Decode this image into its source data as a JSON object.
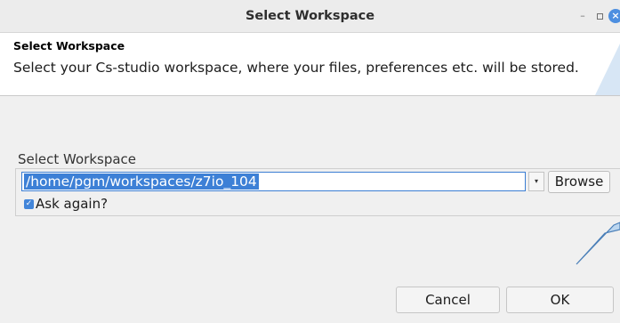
{
  "window": {
    "title": "Select Workspace",
    "minimize_glyph": "–",
    "close_glyph": "×"
  },
  "header": {
    "title": "Select Workspace",
    "description": "Select your Cs-studio workspace, where your files, preferences etc. will be stored."
  },
  "workspace_group": {
    "label": "Select Workspace",
    "path_value": "/home/pgm/workspaces/z7io_104",
    "dropdown_glyph": "▾",
    "browse_label": "Browse",
    "ask_again_label": "Ask again?",
    "ask_again_checked": true
  },
  "buttons": {
    "cancel_label": "Cancel",
    "ok_label": "OK"
  },
  "colors": {
    "accent": "#3d80d6",
    "callout_fill": "#bcd6ef",
    "callout_stroke": "#4a7fb8"
  }
}
